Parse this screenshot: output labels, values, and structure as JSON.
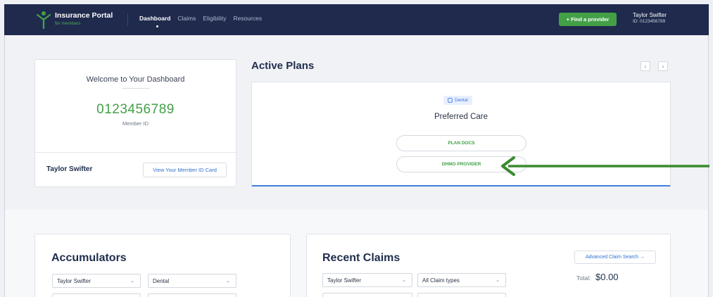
{
  "header": {
    "logo_title": "Insurance Portal",
    "logo_subtitle": "for members",
    "nav": [
      {
        "label": "Dashboard",
        "active": true
      },
      {
        "label": "Claims",
        "active": false
      },
      {
        "label": "Eligibility",
        "active": false
      },
      {
        "label": "Resources",
        "active": false
      }
    ],
    "find_provider_label": "+ Find a provider",
    "user_name": "Taylor Swifter",
    "user_id": "ID: 0123456789"
  },
  "welcome": {
    "title": "Welcome to Your Dashboard",
    "member_number": "0123456789",
    "member_label": "Member ID",
    "name": "Taylor Swifter",
    "id_card_button": "View Your Member ID Card"
  },
  "active_plans": {
    "title": "Active Plans",
    "prev_icon": "‹",
    "next_icon": "›",
    "plan_type": "Dental",
    "plan_name": "Preferred Care",
    "plan_docs_button": "PLAN DOCS",
    "dhmo_provider_button": "DHMO PROVIDER"
  },
  "accumulators": {
    "title": "Accumulators",
    "member_select": "Taylor Swifter",
    "type_select": "Dental"
  },
  "recent_claims": {
    "title": "Recent Claims",
    "member_select": "Taylor Swifter",
    "type_select": "All Claim types",
    "advanced_search": "Advanced Claim Search →",
    "total_label": "Total:",
    "total_value": "$0.00"
  },
  "colors": {
    "header_bg": "#1f2a4d",
    "brand_green": "#43a047",
    "link_blue": "#2f6fd0",
    "accent_blue": "#3f7fdf",
    "annotation_arrow": "#3a8a2e"
  },
  "icons": {
    "logo": "person-figure-icon",
    "dental": "tooth-icon",
    "chevron": "chevron-down-icon",
    "annotation": "arrow-left-icon"
  }
}
